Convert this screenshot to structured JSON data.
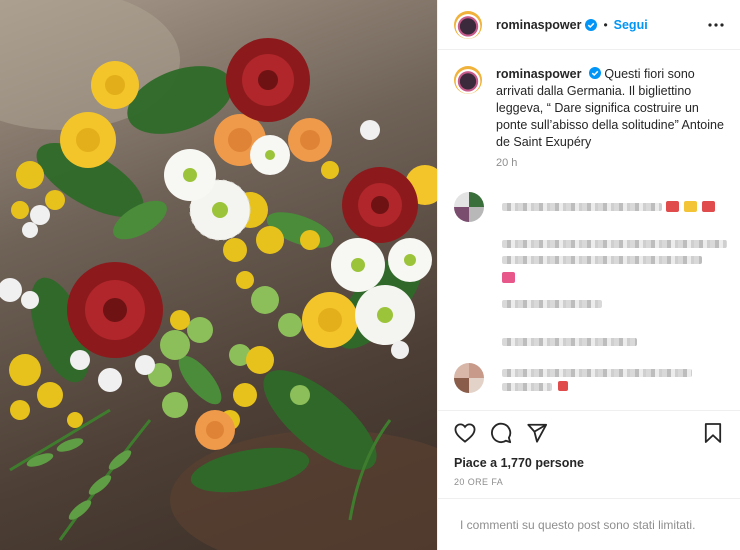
{
  "post": {
    "username": "rominaspower",
    "follow_label": "Segui",
    "separator": "•",
    "caption_text": "Questi fiori sono arrivati dalla Germania. Il bigliettino leggeva, “ Dare significa costruire un ponte sull’abisso della solitudine” Antoine de Saint Exupéry",
    "caption_time": "20 h",
    "likes_text": "Piace a 1,770 persone",
    "post_time": "20 ORE FA",
    "comments_limited_text": "I commenti su questo post sono stati limitati."
  },
  "icons": {
    "verified": "verified-badge-icon",
    "more": "more-options-icon",
    "like": "heart-icon",
    "comment": "comment-icon",
    "share": "send-icon",
    "save": "bookmark-icon"
  },
  "colors": {
    "accent": "#0095f6",
    "text": "#262626",
    "muted": "#8e8e8e",
    "border": "#efefef"
  }
}
